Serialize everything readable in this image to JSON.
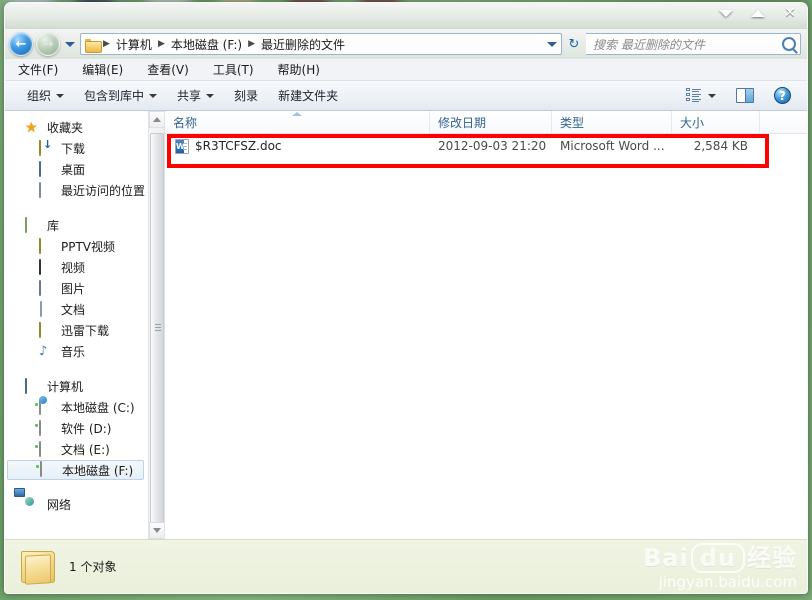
{
  "window": {
    "buttons": [
      {
        "name": "minimize",
        "glyph": "▼"
      },
      {
        "name": "maximize",
        "glyph": "▲"
      },
      {
        "name": "close",
        "glyph": "✕"
      }
    ]
  },
  "address_bar": {
    "back_glyph": "←",
    "forward_glyph": "→",
    "refresh_glyph": "↻",
    "separator": "▶",
    "breadcrumbs": [
      "计算机",
      "本地磁盘 (F:)",
      "最近删除的文件"
    ]
  },
  "search": {
    "placeholder": "搜索 最近删除的文件",
    "value": ""
  },
  "menubar": {
    "items": [
      {
        "label": "文件(F)"
      },
      {
        "label": "编辑(E)"
      },
      {
        "label": "查看(V)"
      },
      {
        "label": "工具(T)"
      },
      {
        "label": "帮助(H)"
      }
    ]
  },
  "toolbar": {
    "items": [
      {
        "label": "组织",
        "has_caret": true
      },
      {
        "label": "包含到库中",
        "has_caret": true
      },
      {
        "label": "共享",
        "has_caret": true
      },
      {
        "label": "刻录",
        "has_caret": false
      },
      {
        "label": "新建文件夹",
        "has_caret": false
      }
    ],
    "help_glyph": "?"
  },
  "sidebar": {
    "groups": [
      {
        "header": {
          "label": "收藏夹",
          "icon": "star-icon"
        },
        "items": [
          {
            "label": "下载",
            "icon": "download-folder-icon"
          },
          {
            "label": "桌面",
            "icon": "desktop-icon"
          },
          {
            "label": "最近访问的位置",
            "icon": "recent-places-icon"
          }
        ]
      },
      {
        "header": {
          "label": "库",
          "icon": "library-icon"
        },
        "items": [
          {
            "label": "PPTV视频",
            "icon": "folder-icon"
          },
          {
            "label": "视频",
            "icon": "video-icon"
          },
          {
            "label": "图片",
            "icon": "picture-icon"
          },
          {
            "label": "文档",
            "icon": "document-icon"
          },
          {
            "label": "迅雷下载",
            "icon": "folder-icon"
          },
          {
            "label": "音乐",
            "icon": "music-icon"
          }
        ]
      },
      {
        "header": {
          "label": "计算机",
          "icon": "computer-icon"
        },
        "items": [
          {
            "label": "本地磁盘 (C:)",
            "icon": "system-drive-icon",
            "selected": false
          },
          {
            "label": "软件 (D:)",
            "icon": "drive-icon",
            "selected": false
          },
          {
            "label": "文档 (E:)",
            "icon": "drive-icon",
            "selected": false
          },
          {
            "label": "本地磁盘 (F:)",
            "icon": "drive-icon",
            "selected": true
          }
        ]
      },
      {
        "header": {
          "label": "网络",
          "icon": "network-icon"
        },
        "items": []
      }
    ]
  },
  "file_list": {
    "columns": [
      {
        "key": "name",
        "label": "名称",
        "sorted": "asc"
      },
      {
        "key": "date",
        "label": "修改日期",
        "sorted": ""
      },
      {
        "key": "type",
        "label": "类型",
        "sorted": ""
      },
      {
        "key": "size",
        "label": "大小",
        "sorted": ""
      }
    ],
    "rows": [
      {
        "name": "$R3TCFSZ.doc",
        "date": "2012-09-03 21:20",
        "type": "Microsoft Word ...",
        "size": "2,584 KB",
        "icon": "word-document-icon",
        "highlighted": true
      }
    ],
    "highlight_color": "#ff0000"
  },
  "statusbar": {
    "text": "1 个对象",
    "icon": "folder-icon"
  },
  "watermark": {
    "brand_left": "Bai",
    "brand_mid": "du",
    "brand_right": "经验",
    "url": "jingyan.baidu.com"
  }
}
